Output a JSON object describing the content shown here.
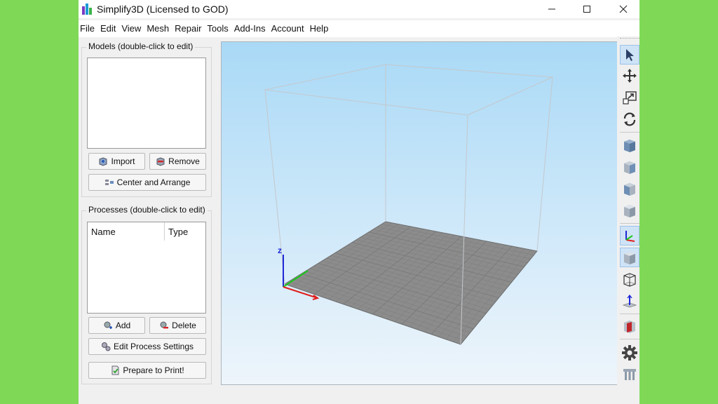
{
  "window": {
    "title": "Simplify3D (Licensed to GOD)",
    "controls": [
      "minimize-icon",
      "maximize-icon",
      "close-icon"
    ]
  },
  "menu": {
    "items": [
      "File",
      "Edit",
      "View",
      "Mesh",
      "Repair",
      "Tools",
      "Add-Ins",
      "Account",
      "Help"
    ]
  },
  "models": {
    "title": "Models (double-click to edit)",
    "import_label": "Import",
    "remove_label": "Remove",
    "center_label": "Center and Arrange"
  },
  "processes": {
    "title": "Processes (double-click to edit)",
    "columns": [
      "Name",
      "Type"
    ],
    "add_label": "Add",
    "delete_label": "Delete",
    "edit_label": "Edit Process Settings",
    "prepare_label": "Prepare to Print!"
  },
  "viewport": {
    "axis_label": "z",
    "colors": {
      "x_axis": "#e0201c",
      "y_axis": "#1ec81e",
      "z_axis": "#1e28d8",
      "bed": "#8c8c8c",
      "grid": "#7a7a7a",
      "box": "#c4c8cc"
    }
  },
  "toolbar": {
    "icons": [
      "select-arrow-icon",
      "move-icon",
      "scale-icon",
      "rotate-icon",
      "view-cube-1-icon",
      "view-cube-2-icon",
      "view-cube-3-icon",
      "view-cube-4-icon",
      "axes-toggle-icon",
      "solid-view-icon",
      "wireframe-view-icon",
      "bed-toggle-icon",
      "cross-section-icon",
      "settings-gear-icon",
      "supports-icon"
    ],
    "active": [
      "select-arrow-icon",
      "axes-toggle-icon",
      "solid-view-icon"
    ]
  }
}
